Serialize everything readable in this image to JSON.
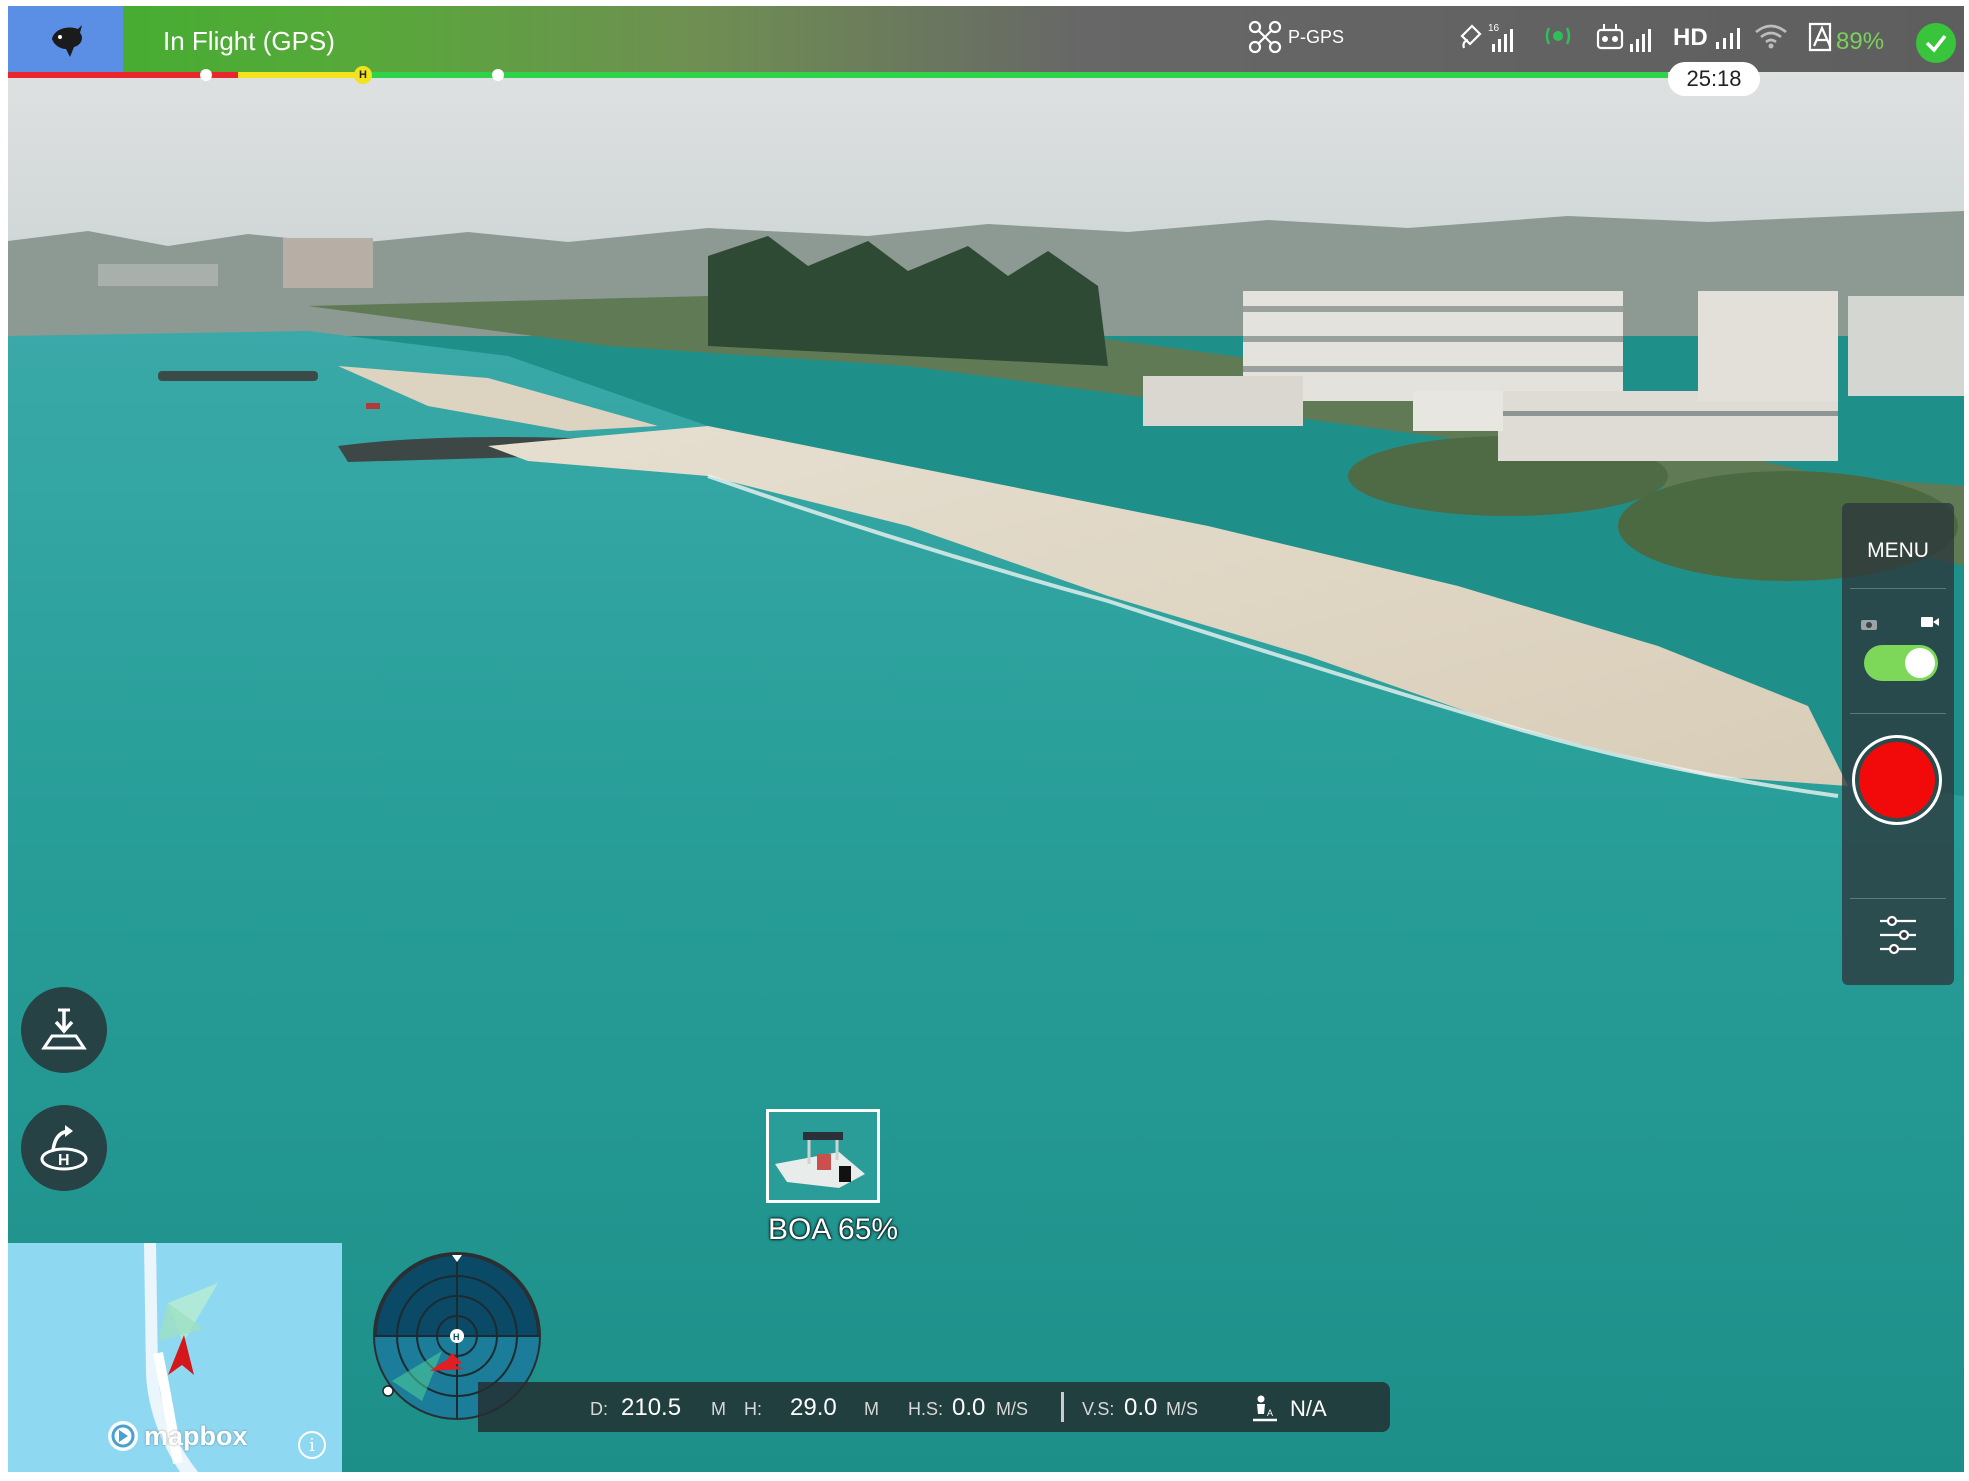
{
  "status_bar": {
    "flight_status": "In Flight (GPS)",
    "flight_mode": "P-GPS",
    "gps_satellites": "16",
    "video_link": "HD",
    "battery_percent": "89%",
    "remaining_flight_time": "25:18",
    "home_marker": "H",
    "icons": [
      "drone-logo-icon",
      "aircraft-icon",
      "satellite-signal-icon",
      "obstacle-sensing-icon",
      "remote-controller-signal-icon",
      "hd-video-signal-icon",
      "wifi-icon",
      "battery-icon",
      "status-ok-icon"
    ],
    "colors": {
      "ok": "#38c53b",
      "battery_text": "#7bd05b",
      "progress_critical": "#e8262b",
      "progress_low": "#f2e31d",
      "progress_ok": "#2fd34a"
    }
  },
  "camera_panel": {
    "menu_label": "MENU",
    "capture_mode": "video",
    "icons": [
      "photo-mode-icon",
      "video-mode-icon",
      "record-icon",
      "camera-settings-icon"
    ]
  },
  "left_actions": {
    "icons": [
      "auto-land-icon",
      "return-to-home-icon"
    ]
  },
  "detection": {
    "label": "BOA 65%"
  },
  "map": {
    "attribution": "mapbox",
    "info_symbol": "i",
    "icons": [
      "mapbox-logo-icon",
      "aircraft-position-icon"
    ]
  },
  "telemetry": {
    "distance_label": "D:",
    "distance_value": "210.5",
    "distance_unit": "M",
    "height_label": "H:",
    "height_value": "29.0",
    "height_unit": "M",
    "hspeed_label": "H.S:",
    "hspeed_value": "0.0",
    "hspeed_unit": "M/S",
    "vspeed_label": "V.S:",
    "vspeed_value": "0.0",
    "vspeed_unit": "M/S",
    "vps_value": "N/A",
    "icons": [
      "vision-positioning-icon"
    ]
  }
}
